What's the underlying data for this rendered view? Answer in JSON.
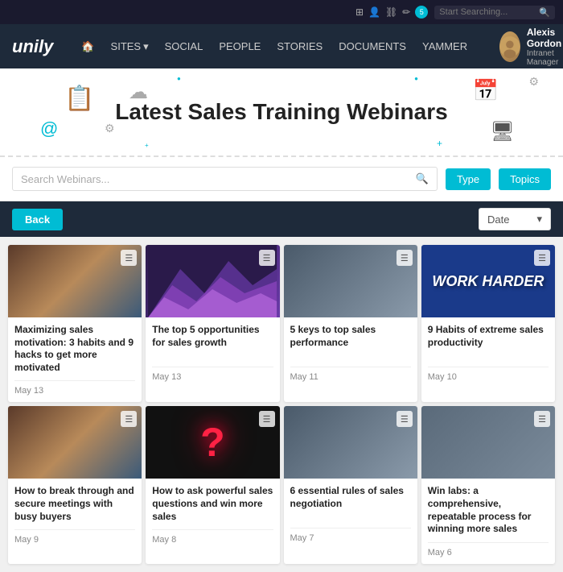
{
  "topbar": {
    "search_placeholder": "Start Searching...",
    "notification_count": "5"
  },
  "nav": {
    "logo": "unily",
    "home_label": "🏠",
    "sites_label": "SITES",
    "social_label": "SOCIAL",
    "people_label": "PEOPLE",
    "stories_label": "STORIES",
    "documents_label": "DOCUMENTS",
    "yammer_label": "YAMMER",
    "user_name": "Alexis Gordon",
    "user_role": "Intranet Manager"
  },
  "hero": {
    "title": "Latest Sales Training Webinars"
  },
  "search": {
    "placeholder": "Search Webinars...",
    "type_btn": "Type",
    "topics_btn": "Topics"
  },
  "toolbar": {
    "back_btn": "Back",
    "date_filter": "Date"
  },
  "cards": [
    {
      "title": "Maximizing sales motivation: 3 habits and 9 hacks to get more motivated",
      "date": "May 13",
      "thumb_class": "thumb-1",
      "thumb_type": "image"
    },
    {
      "title": "The top 5 opportunities for sales growth",
      "date": "May 13",
      "thumb_class": "thumb-2",
      "thumb_type": "mountains"
    },
    {
      "title": "5 keys to top sales performance",
      "date": "May 11",
      "thumb_class": "thumb-3",
      "thumb_type": "image"
    },
    {
      "title": "9 Habits of extreme sales productivity",
      "date": "May 10",
      "thumb_class": "thumb-4",
      "thumb_type": "text",
      "thumb_text": "WORK HARDER"
    },
    {
      "title": "How to break through and secure meetings with busy buyers",
      "date": "May 9",
      "thumb_class": "thumb-5",
      "thumb_type": "image"
    },
    {
      "title": "How to ask powerful sales questions and win more sales",
      "date": "May 8",
      "thumb_class": "thumb-6",
      "thumb_type": "question"
    },
    {
      "title": "6 essential rules of sales negotiation",
      "date": "May 7",
      "thumb_class": "thumb-7",
      "thumb_type": "image"
    },
    {
      "title": "Win labs: a comprehensive, repeatable process for winning more sales",
      "date": "May 6",
      "thumb_class": "thumb-8",
      "thumb_type": "image"
    }
  ]
}
